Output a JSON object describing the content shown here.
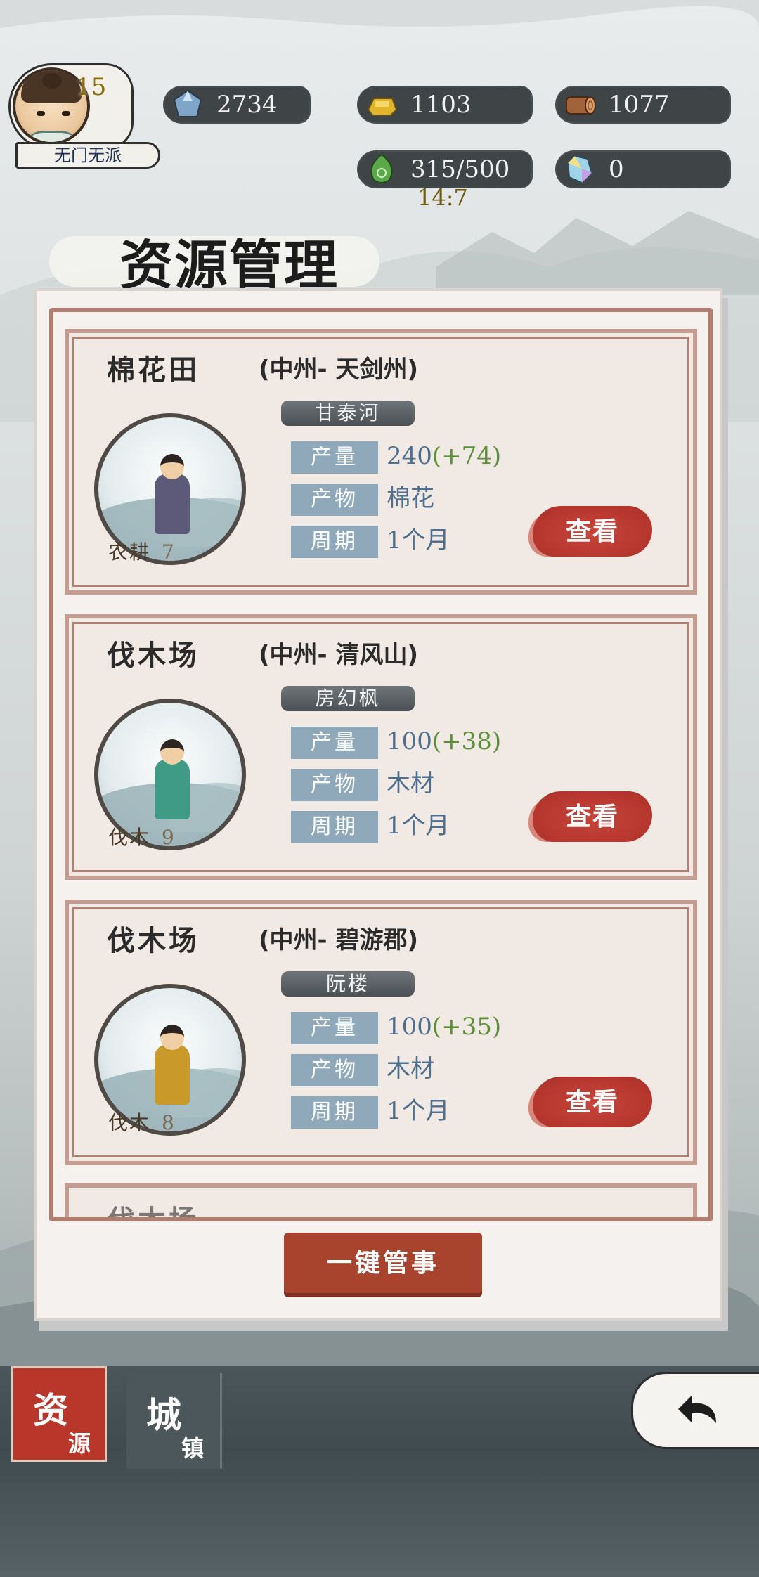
{
  "player": {
    "level": "15",
    "sect": "无门无派"
  },
  "resources": {
    "crystal": "2734",
    "gold": "1103",
    "wood": "1077",
    "stamina": "315/500",
    "stamina_timer": "14:7",
    "gem": "0"
  },
  "page_title": "资源管理",
  "cards": [
    {
      "title": "棉花田",
      "location": "(中州- 天剑州)",
      "npc": "甘泰河",
      "skill_name": "农耕",
      "skill_level": "7",
      "labels": {
        "output": "产量",
        "product": "产物",
        "cycle": "周期"
      },
      "output_value": "240",
      "output_bonus": "(+74)",
      "product_value": "棉花",
      "cycle_value": "1个月",
      "button": "查看",
      "robe_color": "#5c5a78"
    },
    {
      "title": "伐木场",
      "location": "(中州- 清风山)",
      "npc": "房幻枫",
      "skill_name": "伐木",
      "skill_level": "9",
      "labels": {
        "output": "产量",
        "product": "产物",
        "cycle": "周期"
      },
      "output_value": "100",
      "output_bonus": "(+38)",
      "product_value": "木材",
      "cycle_value": "1个月",
      "button": "查看",
      "robe_color": "#3f9a86"
    },
    {
      "title": "伐木场",
      "location": "(中州- 碧游郡)",
      "npc": "阮楼",
      "skill_name": "伐木",
      "skill_level": "8",
      "labels": {
        "output": "产量",
        "product": "产物",
        "cycle": "周期"
      },
      "output_value": "100",
      "output_bonus": "(+35)",
      "product_value": "木材",
      "cycle_value": "1个月",
      "button": "查看",
      "robe_color": "#c99a2a"
    }
  ],
  "peek_card_title": "伐木场",
  "one_key_button": "一键管事",
  "nav": {
    "tab1_big": "资",
    "tab1_small": "源",
    "tab2_big": "城",
    "tab2_small": "镇"
  },
  "colors": {
    "accent_red": "#b9362b",
    "label_blue": "#8fa9bb",
    "bonus_green": "#5b8f39"
  }
}
